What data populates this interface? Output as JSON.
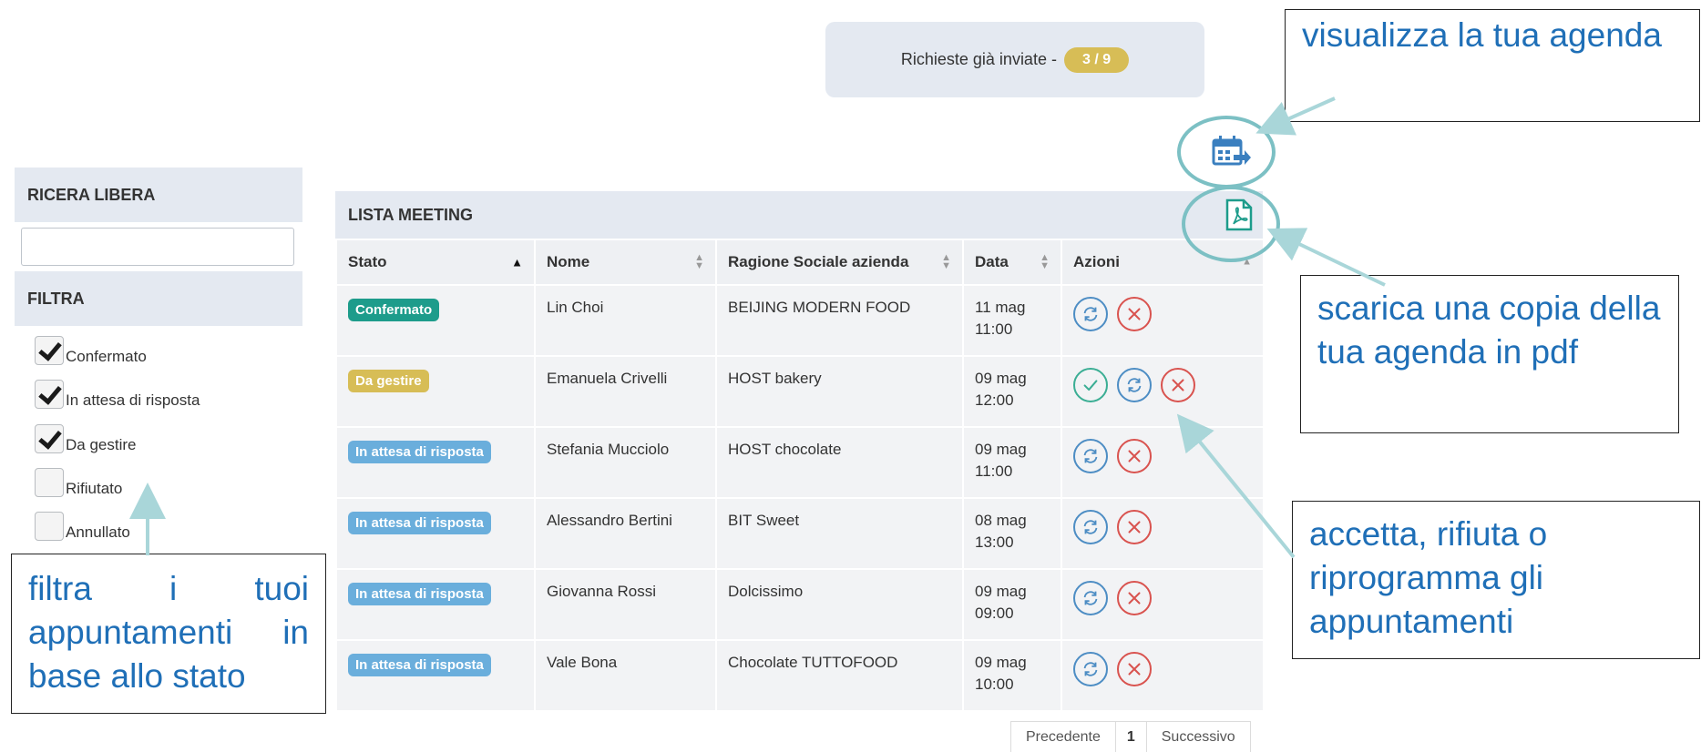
{
  "requests": {
    "label": "Richieste già inviate -",
    "count": "3 / 9"
  },
  "sidebar": {
    "search_heading": "RICERA LIBERA",
    "search_value": "",
    "filter_heading": "FILTRA",
    "filters": [
      {
        "label": "Confermato",
        "checked": true
      },
      {
        "label": "In attesa di risposta",
        "checked": true
      },
      {
        "label": "Da gestire",
        "checked": true
      },
      {
        "label": "Rifiutato",
        "checked": false
      },
      {
        "label": "Annullato",
        "checked": false
      }
    ]
  },
  "meetings": {
    "title": "LISTA MEETING",
    "columns": [
      "Stato",
      "Nome",
      "Ragione Sociale azienda",
      "Data",
      "Azioni"
    ],
    "rows": [
      {
        "status": "Confermato",
        "status_color": "#1d9c8b",
        "name": "Lin Choi",
        "company": "BEIJING MODERN FOOD",
        "date": "11 mag",
        "time": "11:00",
        "actions": [
          "reschedule",
          "reject"
        ]
      },
      {
        "status": "Da gestire",
        "status_color": "#d7bd56",
        "name": "Emanuela Crivelli",
        "company": "HOST bakery",
        "date": "09 mag",
        "time": "12:00",
        "actions": [
          "accept",
          "reschedule",
          "reject"
        ]
      },
      {
        "status": "In attesa di risposta",
        "status_color": "#6aaedc",
        "name": "Stefania Mucciolo",
        "company": "HOST chocolate",
        "date": "09 mag",
        "time": "11:00",
        "actions": [
          "reschedule",
          "reject"
        ]
      },
      {
        "status": "In attesa di risposta",
        "status_color": "#6aaedc",
        "name": "Alessandro Bertini",
        "company": "BIT Sweet",
        "date": "08 mag",
        "time": "13:00",
        "actions": [
          "reschedule",
          "reject"
        ]
      },
      {
        "status": "In attesa di risposta",
        "status_color": "#6aaedc",
        "name": "Giovanna Rossi",
        "company": "Dolcissimo",
        "date": "09 mag",
        "time": "09:00",
        "actions": [
          "reschedule",
          "reject"
        ]
      },
      {
        "status": "In attesa di risposta",
        "status_color": "#6aaedc",
        "name": "Vale Bona",
        "company": "Chocolate TUTTOFOOD",
        "date": "09 mag",
        "time": "10:00",
        "actions": [
          "reschedule",
          "reject"
        ]
      }
    ]
  },
  "pagination": {
    "prev": "Precedente",
    "current": "1",
    "next": "Successivo"
  },
  "annotations": {
    "agenda": "visualizza la tua agenda",
    "pdf": "scarica una copia della tua agenda in pdf",
    "actions": "accetta, rifiuta o riprogramma gli appuntamenti",
    "filter": "filtra i tuoi appuntamenti in base allo stato"
  },
  "icons": {
    "agenda": "calendar-arrow-icon",
    "pdf": "pdf-file-icon"
  }
}
